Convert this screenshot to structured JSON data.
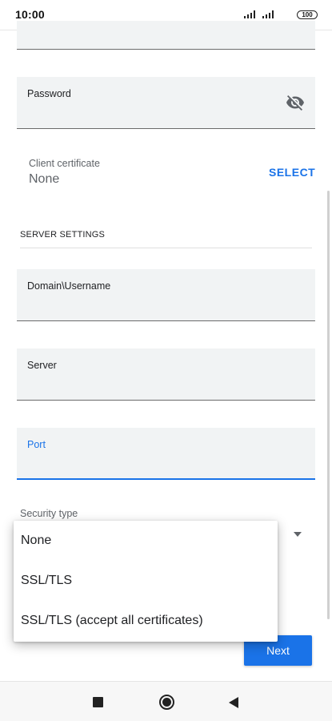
{
  "status_bar": {
    "time": "10:00",
    "battery": "100"
  },
  "form": {
    "password_label": "Password",
    "client_certificate": {
      "label": "Client certificate",
      "value": "None",
      "select_label": "SELECT"
    },
    "server_settings_title": "SERVER SETTINGS",
    "domain_username_label": "Domain\\Username",
    "server_label": "Server",
    "port_label": "Port",
    "security_type_label": "Security type"
  },
  "security_menu": {
    "options": [
      "None",
      "SSL/TLS",
      "SSL/TLS (accept all certificates)"
    ]
  },
  "next_label": "Next",
  "colors": {
    "accent": "#1a73e8",
    "field_bg": "#f1f3f4"
  }
}
